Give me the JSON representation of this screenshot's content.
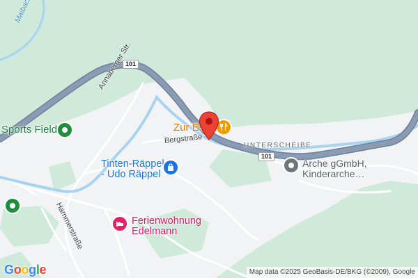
{
  "map": {
    "places": {
      "sports_field": "Sports Field",
      "tinten_line1": "Tinten-Räppel",
      "tinten_line2": "- Udo Räppel",
      "ferien_line1": "Ferienwohnung",
      "ferien_line2": "Edelmann",
      "zur_essen": "Zur Ess",
      "arche_line1": "Arche gGmbH,",
      "arche_line2": "Kinderarche…"
    },
    "streets": {
      "annaberger": "Annaberger Str.",
      "bergstrasse": "Bergstraße",
      "hammerstrasse": "Hammerstraße"
    },
    "district": "UNTERSCHEIBE",
    "water": "Maibach",
    "road_shields": [
      "101",
      "101"
    ],
    "colors": {
      "park": "#cfeadb",
      "built_up": "#f1f3f4",
      "highway": "#8a9cb4",
      "river": "#a8d4f2",
      "marker": "#ea4335"
    },
    "icons": {
      "sports_field": "green-circle-icon",
      "tinten": "shopping-bag-icon",
      "ferien": "bed-icon",
      "zur_essen": "fork-knife-icon",
      "arche": "grey-circle-icon",
      "marker": "red-map-pin-icon",
      "left_edge": "green-circle-icon"
    },
    "branding": {
      "logo": "Google",
      "attribution": "Map data ©2025 GeoBasis-DE/BKG (©2009), Google"
    }
  }
}
